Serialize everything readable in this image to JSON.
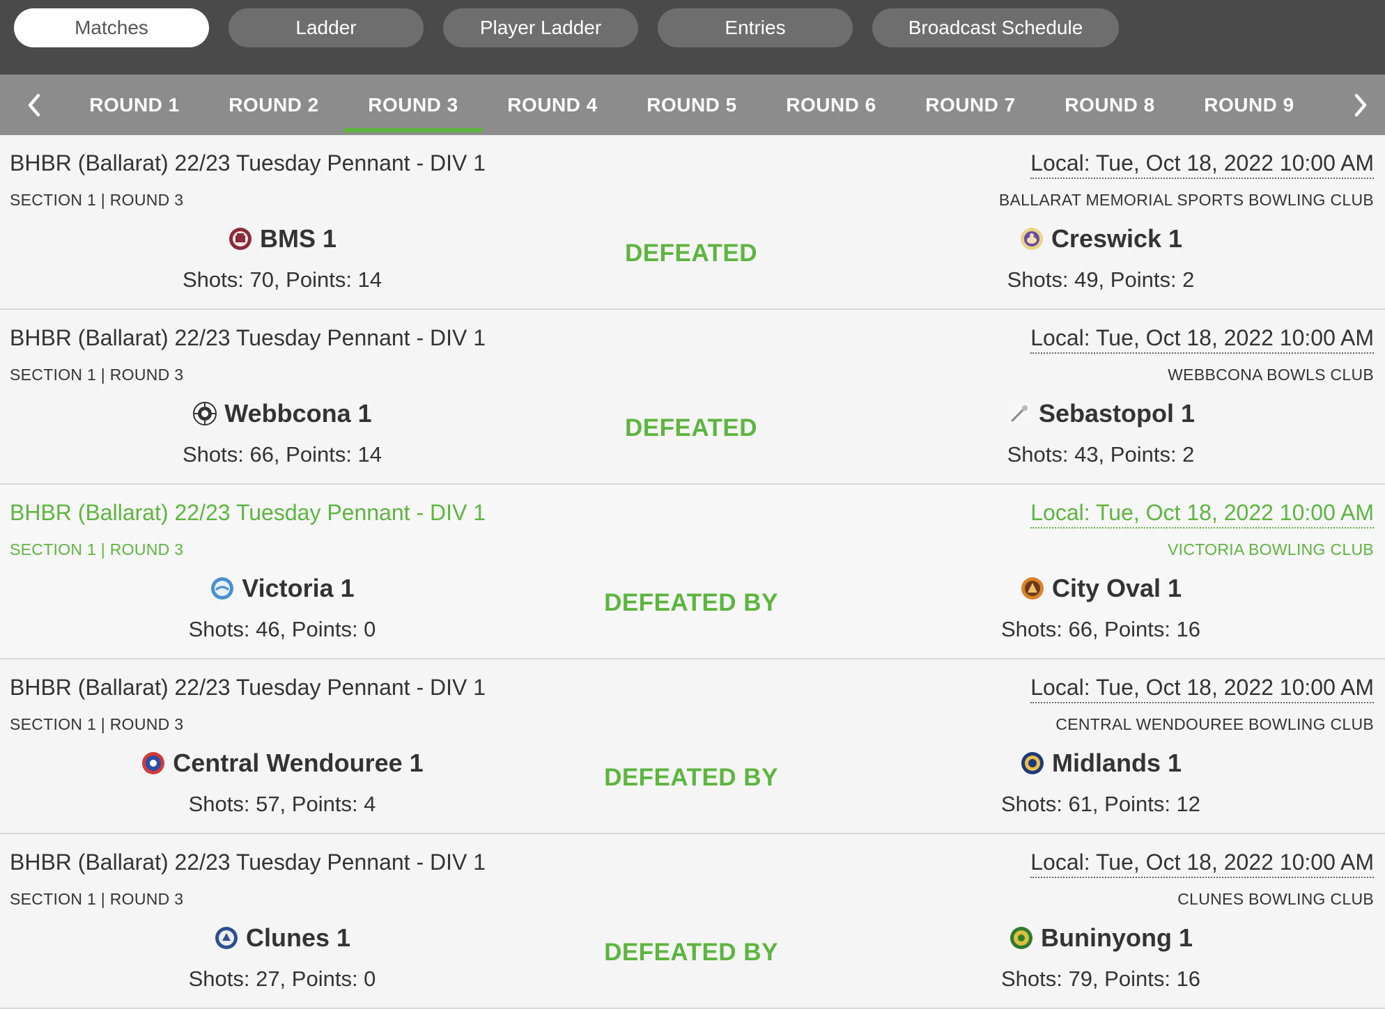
{
  "nav": {
    "pills": [
      "Matches",
      "Ladder",
      "Player Ladder",
      "Entries",
      "Broadcast Schedule"
    ],
    "active_pill": "Matches"
  },
  "rounds": {
    "tabs": [
      "ROUND 1",
      "ROUND 2",
      "ROUND 3",
      "ROUND 4",
      "ROUND 5",
      "ROUND 6",
      "ROUND 7",
      "ROUND 8",
      "ROUND 9"
    ],
    "active": "ROUND 3",
    "prev_icon": "chevron-left-icon",
    "next_icon": "chevron-right-icon"
  },
  "colors": {
    "accent": "#5db53f",
    "topbar": "#4a4a4a",
    "roundbar": "#8c8c8c"
  },
  "matches": [
    {
      "competition": "BHBR (Ballarat) 22/23 Tuesday Pennant - DIV 1",
      "section": "SECTION 1 | ROUND 3",
      "local_time": "Local: Tue, Oct 18, 2022 10:00 AM",
      "venue": "BALLARAT MEMORIAL SPORTS BOWLING CLUB",
      "home": {
        "name": "BMS 1",
        "score": "Shots: 70, Points: 14",
        "logo": "bms-logo-icon"
      },
      "result": "DEFEATED",
      "away": {
        "name": "Creswick 1",
        "score": "Shots: 49, Points: 2",
        "logo": "creswick-logo-icon"
      }
    },
    {
      "competition": "BHBR (Ballarat) 22/23 Tuesday Pennant - DIV 1",
      "section": "SECTION 1 | ROUND 3",
      "local_time": "Local: Tue, Oct 18, 2022 10:00 AM",
      "venue": "WEBBCONA BOWLS CLUB",
      "home": {
        "name": "Webbcona 1",
        "score": "Shots: 66, Points: 14",
        "logo": "webbcona-logo-icon"
      },
      "result": "DEFEATED",
      "away": {
        "name": "Sebastopol 1",
        "score": "Shots: 43, Points: 2",
        "logo": "sebastopol-logo-icon"
      }
    },
    {
      "competition": "BHBR (Ballarat) 22/23 Tuesday Pennant - DIV 1",
      "section": "SECTION 1 | ROUND 3",
      "local_time": "Local: Tue, Oct 18, 2022 10:00 AM",
      "venue": "VICTORIA BOWLING CLUB",
      "home": {
        "name": "Victoria 1",
        "score": "Shots: 46, Points: 0",
        "logo": "victoria-logo-icon"
      },
      "result": "DEFEATED BY",
      "away": {
        "name": "City Oval 1",
        "score": "Shots: 66, Points: 16",
        "logo": "city-oval-logo-icon"
      }
    },
    {
      "competition": "BHBR (Ballarat) 22/23 Tuesday Pennant - DIV 1",
      "section": "SECTION 1 | ROUND 3",
      "local_time": "Local: Tue, Oct 18, 2022 10:00 AM",
      "venue": "CENTRAL WENDOUREE BOWLING CLUB",
      "home": {
        "name": "Central Wendouree 1",
        "score": "Shots: 57, Points: 4",
        "logo": "central-wendouree-logo-icon"
      },
      "result": "DEFEATED BY",
      "away": {
        "name": "Midlands 1",
        "score": "Shots: 61, Points: 12",
        "logo": "midlands-logo-icon"
      }
    },
    {
      "competition": "BHBR (Ballarat) 22/23 Tuesday Pennant - DIV 1",
      "section": "SECTION 1 | ROUND 3",
      "local_time": "Local: Tue, Oct 18, 2022 10:00 AM",
      "venue": "CLUNES BOWLING CLUB",
      "home": {
        "name": "Clunes 1",
        "score": "Shots: 27, Points: 0",
        "logo": "clunes-logo-icon"
      },
      "result": "DEFEATED BY",
      "away": {
        "name": "Buninyong 1",
        "score": "Shots: 79, Points: 16",
        "logo": "buninyong-logo-icon"
      }
    }
  ]
}
